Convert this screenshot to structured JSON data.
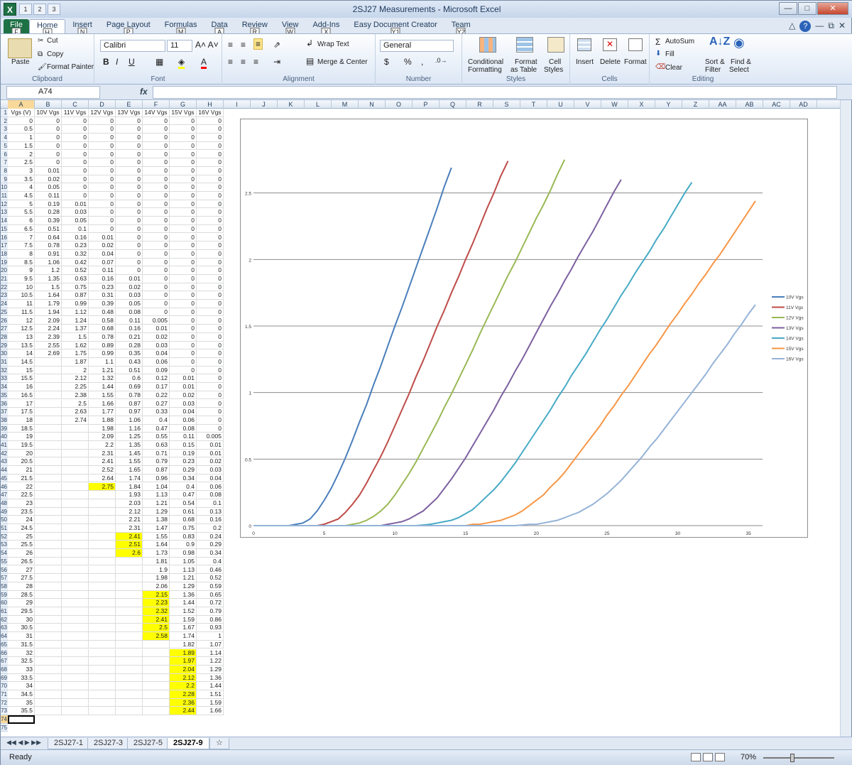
{
  "window": {
    "title": "2SJ27 Measurements - Microsoft Excel",
    "app_icon": "X"
  },
  "qat": [
    "1",
    "2",
    "3"
  ],
  "ribbon_tabs": [
    {
      "label": "File",
      "key": "F"
    },
    {
      "label": "Home",
      "key": "H"
    },
    {
      "label": "Insert",
      "key": "N"
    },
    {
      "label": "Page Layout",
      "key": "P"
    },
    {
      "label": "Formulas",
      "key": "M"
    },
    {
      "label": "Data",
      "key": "A"
    },
    {
      "label": "Review",
      "key": "R"
    },
    {
      "label": "View",
      "key": "W"
    },
    {
      "label": "Add-Ins",
      "key": "X"
    },
    {
      "label": "Easy Document Creator",
      "key": "Y1"
    },
    {
      "label": "Team",
      "key": "Y2"
    }
  ],
  "ribbon": {
    "clipboard": {
      "paste": "Paste",
      "cut": "Cut",
      "copy": "Copy",
      "format_painter": "Format Painter",
      "label": "Clipboard"
    },
    "font": {
      "name": "Calibri",
      "size": "11",
      "label": "Font"
    },
    "alignment": {
      "wrap": "Wrap Text",
      "merge": "Merge & Center",
      "label": "Alignment"
    },
    "number": {
      "format": "General",
      "label": "Number"
    },
    "styles": {
      "conditional": "Conditional",
      "conditional2": "Formatting",
      "format_table": "Format",
      "format_table2": "as Table",
      "cell_styles": "Cell",
      "cell_styles2": "Styles",
      "label": "Styles"
    },
    "cells": {
      "insert": "Insert",
      "delete": "Delete",
      "format": "Format",
      "label": "Cells"
    },
    "editing": {
      "autosum": "AutoSum",
      "fill": "Fill",
      "clear": "Clear",
      "sort": "Sort &",
      "sort2": "Filter",
      "find": "Find &",
      "find2": "Select",
      "label": "Editing"
    }
  },
  "formula_bar": {
    "name_box": "A74",
    "fx": "fx",
    "formula": ""
  },
  "columns": [
    "A",
    "B",
    "C",
    "D",
    "E",
    "F",
    "G",
    "H",
    "I",
    "J",
    "K",
    "L",
    "M",
    "N",
    "O",
    "P",
    "Q",
    "R",
    "S",
    "T",
    "U",
    "V",
    "W",
    "X",
    "Y",
    "Z",
    "AA",
    "AB",
    "AC",
    "AD"
  ],
  "headers": [
    "Vgs (V)",
    "10V Vgs",
    "11V Vgs",
    "12V Vgs",
    "13V Vgs",
    "14V Vgs",
    "15V Vgs",
    "16V Vgs"
  ],
  "rows": [
    [
      "0",
      "0",
      "0",
      "0",
      "0",
      "0",
      "0",
      "0"
    ],
    [
      "0.5",
      "0",
      "0",
      "0",
      "0",
      "0",
      "0",
      "0"
    ],
    [
      "1",
      "0",
      "0",
      "0",
      "0",
      "0",
      "0",
      "0"
    ],
    [
      "1.5",
      "0",
      "0",
      "0",
      "0",
      "0",
      "0",
      "0"
    ],
    [
      "2",
      "0",
      "0",
      "0",
      "0",
      "0",
      "0",
      "0"
    ],
    [
      "2.5",
      "0",
      "0",
      "0",
      "0",
      "0",
      "0",
      "0"
    ],
    [
      "3",
      "0.01",
      "0",
      "0",
      "0",
      "0",
      "0",
      "0"
    ],
    [
      "3.5",
      "0.02",
      "0",
      "0",
      "0",
      "0",
      "0",
      "0"
    ],
    [
      "4",
      "0.05",
      "0",
      "0",
      "0",
      "0",
      "0",
      "0"
    ],
    [
      "4.5",
      "0.11",
      "0",
      "0",
      "0",
      "0",
      "0",
      "0"
    ],
    [
      "5",
      "0.19",
      "0.01",
      "0",
      "0",
      "0",
      "0",
      "0"
    ],
    [
      "5.5",
      "0.28",
      "0.03",
      "0",
      "0",
      "0",
      "0",
      "0"
    ],
    [
      "6",
      "0.39",
      "0.05",
      "0",
      "0",
      "0",
      "0",
      "0"
    ],
    [
      "6.5",
      "0.51",
      "0.1",
      "0",
      "0",
      "0",
      "0",
      "0"
    ],
    [
      "7",
      "0.64",
      "0.16",
      "0.01",
      "0",
      "0",
      "0",
      "0"
    ],
    [
      "7.5",
      "0.78",
      "0.23",
      "0.02",
      "0",
      "0",
      "0",
      "0"
    ],
    [
      "8",
      "0.91",
      "0.32",
      "0.04",
      "0",
      "0",
      "0",
      "0"
    ],
    [
      "8.5",
      "1.06",
      "0.42",
      "0.07",
      "0",
      "0",
      "0",
      "0"
    ],
    [
      "9",
      "1.2",
      "0.52",
      "0.11",
      "0",
      "0",
      "0",
      "0"
    ],
    [
      "9.5",
      "1.35",
      "0.63",
      "0.16",
      "0.01",
      "0",
      "0",
      "0"
    ],
    [
      "10",
      "1.5",
      "0.75",
      "0.23",
      "0.02",
      "0",
      "0",
      "0"
    ],
    [
      "10.5",
      "1.64",
      "0.87",
      "0.31",
      "0.03",
      "0",
      "0",
      "0"
    ],
    [
      "11",
      "1.79",
      "0.99",
      "0.39",
      "0.05",
      "0",
      "0",
      "0"
    ],
    [
      "11.5",
      "1.94",
      "1.12",
      "0.48",
      "0.08",
      "0",
      "0",
      "0"
    ],
    [
      "12",
      "2.09",
      "1.24",
      "0.58",
      "0.11",
      "0.005",
      "0",
      "0"
    ],
    [
      "12.5",
      "2.24",
      "1.37",
      "0.68",
      "0.16",
      "0.01",
      "0",
      "0"
    ],
    [
      "13",
      "2.39",
      "1.5",
      "0.78",
      "0.21",
      "0.02",
      "0",
      "0"
    ],
    [
      "13.5",
      "2.55",
      "1.62",
      "0.89",
      "0.28",
      "0.03",
      "0",
      "0"
    ],
    [
      "14",
      "2.69",
      "1.75",
      "0.99",
      "0.35",
      "0.04",
      "0",
      "0"
    ],
    [
      "14.5",
      "",
      "1.87",
      "1.1",
      "0.43",
      "0.06",
      "0",
      "0"
    ],
    [
      "15",
      "",
      "2",
      "1.21",
      "0.51",
      "0.09",
      "0",
      "0"
    ],
    [
      "15.5",
      "",
      "2.12",
      "1.32",
      "0.6",
      "0.12",
      "0.01",
      "0"
    ],
    [
      "16",
      "",
      "2.25",
      "1.44",
      "0.69",
      "0.17",
      "0.01",
      "0"
    ],
    [
      "16.5",
      "",
      "2.38",
      "1.55",
      "0.78",
      "0.22",
      "0.02",
      "0"
    ],
    [
      "17",
      "",
      "2.5",
      "1.66",
      "0.87",
      "0.27",
      "0.03",
      "0"
    ],
    [
      "17.5",
      "",
      "2.63",
      "1.77",
      "0.97",
      "0.33",
      "0.04",
      "0"
    ],
    [
      "18",
      "",
      "2.74",
      "1.88",
      "1.06",
      "0.4",
      "0.06",
      "0"
    ],
    [
      "18.5",
      "",
      "",
      "1.98",
      "1.16",
      "0.47",
      "0.08",
      "0"
    ],
    [
      "19",
      "",
      "",
      "2.09",
      "1.25",
      "0.55",
      "0.11",
      "0.005"
    ],
    [
      "19.5",
      "",
      "",
      "2.2",
      "1.35",
      "0.63",
      "0.15",
      "0.01"
    ],
    [
      "20",
      "",
      "",
      "2.31",
      "1.45",
      "0.71",
      "0.19",
      "0.01"
    ],
    [
      "20.5",
      "",
      "",
      "2.41",
      "1.55",
      "0.79",
      "0.23",
      "0.02"
    ],
    [
      "21",
      "",
      "",
      "2.52",
      "1.65",
      "0.87",
      "0.29",
      "0.03"
    ],
    [
      "21.5",
      "",
      "",
      "2.64",
      "1.74",
      "0.96",
      "0.34",
      "0.04"
    ],
    [
      "22",
      "",
      "",
      "2.75",
      "1.84",
      "1.04",
      "0.4",
      "0.06"
    ],
    [
      "22.5",
      "",
      "",
      "",
      "1.93",
      "1.13",
      "0.47",
      "0.08"
    ],
    [
      "23",
      "",
      "",
      "",
      "2.03",
      "1.21",
      "0.54",
      "0.1"
    ],
    [
      "23.5",
      "",
      "",
      "",
      "2.12",
      "1.29",
      "0.61",
      "0.13"
    ],
    [
      "24",
      "",
      "",
      "",
      "2.21",
      "1.38",
      "0.68",
      "0.16"
    ],
    [
      "24.5",
      "",
      "",
      "",
      "2.31",
      "1.47",
      "0.75",
      "0.2"
    ],
    [
      "25",
      "",
      "",
      "",
      "2.41",
      "1.55",
      "0.83",
      "0.24"
    ],
    [
      "25.5",
      "",
      "",
      "",
      "2.51",
      "1.64",
      "0.9",
      "0.29"
    ],
    [
      "26",
      "",
      "",
      "",
      "2.6",
      "1.73",
      "0.98",
      "0.34"
    ],
    [
      "26.5",
      "",
      "",
      "",
      "",
      "1.81",
      "1.05",
      "0.4"
    ],
    [
      "27",
      "",
      "",
      "",
      "",
      "1.9",
      "1.13",
      "0.46"
    ],
    [
      "27.5",
      "",
      "",
      "",
      "",
      "1.98",
      "1.21",
      "0.52"
    ],
    [
      "28",
      "",
      "",
      "",
      "",
      "2.06",
      "1.29",
      "0.59"
    ],
    [
      "28.5",
      "",
      "",
      "",
      "",
      "2.15",
      "1.36",
      "0.65"
    ],
    [
      "29",
      "",
      "",
      "",
      "",
      "2.23",
      "1.44",
      "0.72"
    ],
    [
      "29.5",
      "",
      "",
      "",
      "",
      "2.32",
      "1.52",
      "0.79"
    ],
    [
      "30",
      "",
      "",
      "",
      "",
      "2.41",
      "1.59",
      "0.86"
    ],
    [
      "30.5",
      "",
      "",
      "",
      "",
      "2.5",
      "1.67",
      "0.93"
    ],
    [
      "31",
      "",
      "",
      "",
      "",
      "2.58",
      "1.74",
      "1"
    ],
    [
      "31.5",
      "",
      "",
      "",
      "",
      "",
      "1.82",
      "1.07"
    ],
    [
      "32",
      "",
      "",
      "",
      "",
      "",
      "1.89",
      "1.14"
    ],
    [
      "32.5",
      "",
      "",
      "",
      "",
      "",
      "1.97",
      "1.22"
    ],
    [
      "33",
      "",
      "",
      "",
      "",
      "",
      "2.04",
      "1.29"
    ],
    [
      "33.5",
      "",
      "",
      "",
      "",
      "",
      "2.12",
      "1.36"
    ],
    [
      "34",
      "",
      "",
      "",
      "",
      "",
      "2.2",
      "1.44"
    ],
    [
      "34.5",
      "",
      "",
      "",
      "",
      "",
      "2.28",
      "1.51"
    ],
    [
      "35",
      "",
      "",
      "",
      "",
      "",
      "2.36",
      "1.59"
    ],
    [
      "35.5",
      "",
      "",
      "",
      "",
      "",
      "2.44",
      "1.66"
    ]
  ],
  "highlighted": [
    {
      "row": 46,
      "col": 3
    },
    {
      "row": 52,
      "col": 4
    },
    {
      "row": 53,
      "col": 4
    },
    {
      "row": 54,
      "col": 4
    },
    {
      "row": 59,
      "col": 5
    },
    {
      "row": 60,
      "col": 5
    },
    {
      "row": 61,
      "col": 5
    },
    {
      "row": 62,
      "col": 5
    },
    {
      "row": 63,
      "col": 5
    },
    {
      "row": 64,
      "col": 5
    },
    {
      "row": 66,
      "col": 6
    },
    {
      "row": 67,
      "col": 6
    },
    {
      "row": 68,
      "col": 6
    },
    {
      "row": 69,
      "col": 6
    },
    {
      "row": 70,
      "col": 6
    },
    {
      "row": 71,
      "col": 6
    },
    {
      "row": 72,
      "col": 6
    },
    {
      "row": 73,
      "col": 6
    }
  ],
  "highlight_color": "#ffff00",
  "selected_row": 74,
  "extra_row_numbers": [
    "74",
    "75"
  ],
  "chart_data": {
    "type": "line",
    "title": "",
    "xlabel": "",
    "ylabel": "",
    "xlim": [
      0,
      36
    ],
    "ylim": [
      0,
      3
    ],
    "x_ticks": [
      "0",
      "5",
      "10",
      "15",
      "20",
      "25",
      "30",
      "35"
    ],
    "y_ticks": [
      "0",
      "0.5",
      "1",
      "1.5",
      "2",
      "2.5"
    ],
    "grid": true,
    "legend_position": "right",
    "series": [
      {
        "name": "10V Vgs",
        "color": "#4a7ebb"
      },
      {
        "name": "11V Vgs",
        "color": "#be4b48"
      },
      {
        "name": "12V Vgs",
        "color": "#98b954"
      },
      {
        "name": "13V Vgs",
        "color": "#7d60a0"
      },
      {
        "name": "14V Vgs",
        "color": "#46aac5"
      },
      {
        "name": "15V Vgs",
        "color": "#f79646"
      },
      {
        "name": "16V Vgs",
        "color": "#95b3d7"
      }
    ]
  },
  "sheet_tabs": [
    "2SJ27-1",
    "2SJ27-3",
    "2SJ27-5",
    "2SJ27-9"
  ],
  "active_sheet": "2SJ27-9",
  "status": {
    "ready": "Ready",
    "zoom": "70%"
  }
}
